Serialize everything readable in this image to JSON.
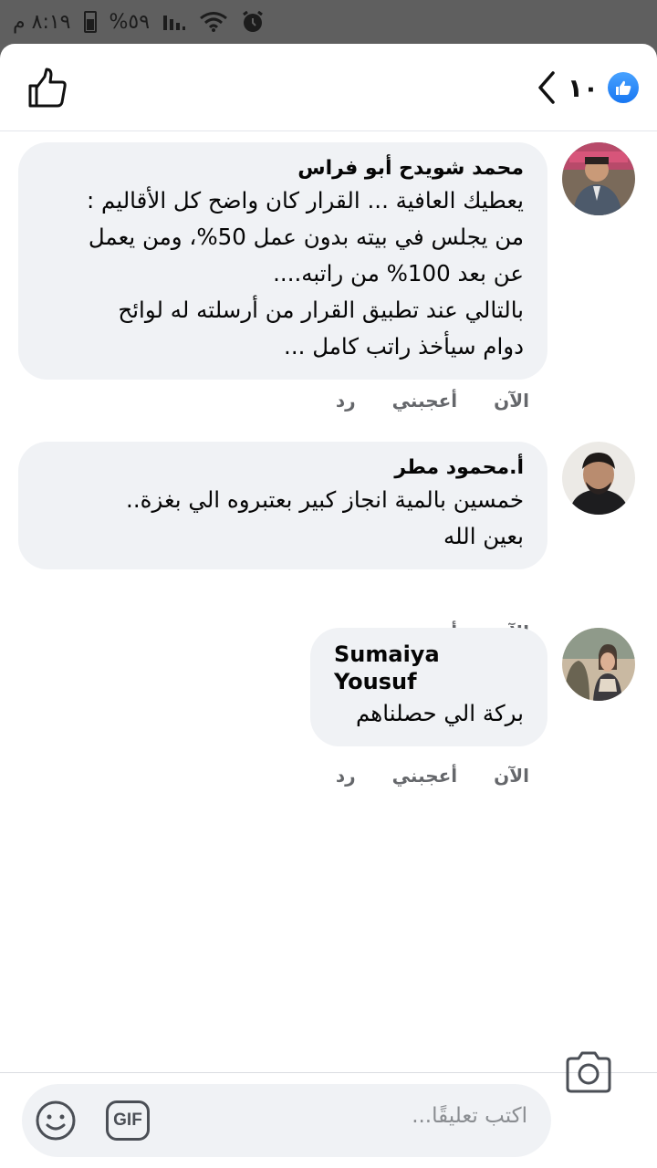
{
  "status_bar": {
    "time": "٨:١٩ م",
    "battery": "%٥٩"
  },
  "header": {
    "like_count": "١٠",
    "icons": [
      "thumbs-up-icon",
      "like-badge-icon",
      "chevron-left-icon"
    ]
  },
  "comments": [
    {
      "author": "محمد شويدح أبو فراس",
      "text": "يعطيك العافية ... القرار كان واضح كل الأقاليم :\nمن يجلس في بيته بدون عمل 50%، ومن يعمل\nعن بعد 100% من راتبه....\nبالتالي عند تطبيق القرار من أرسلته له لوائح\nدوام سيأخذ راتب كامل ...",
      "time": "الآن",
      "like_label": "أعجبني",
      "reply_label": "رد"
    },
    {
      "author": "أ.محمود مطر",
      "text": "خمسين بالمية انجاز كبير بعتبروه الي بغزة..\nبعين الله",
      "time": "الآن",
      "like_label": "أعجبني",
      "reply_label": "رد"
    },
    {
      "author": "Sumaiya Yousuf",
      "text": "بركة الي حصلناهم",
      "time": "الآن",
      "like_label": "أعجبني",
      "reply_label": "رد"
    }
  ],
  "composer": {
    "placeholder": "اكتب تعليقًا...",
    "gif_label": "GIF",
    "icons": [
      "emoji-icon",
      "gif-icon",
      "camera-icon"
    ]
  },
  "colors": {
    "accent": "#1877f2",
    "bubble": "#f0f2f5",
    "meta_text": "#65676b"
  }
}
